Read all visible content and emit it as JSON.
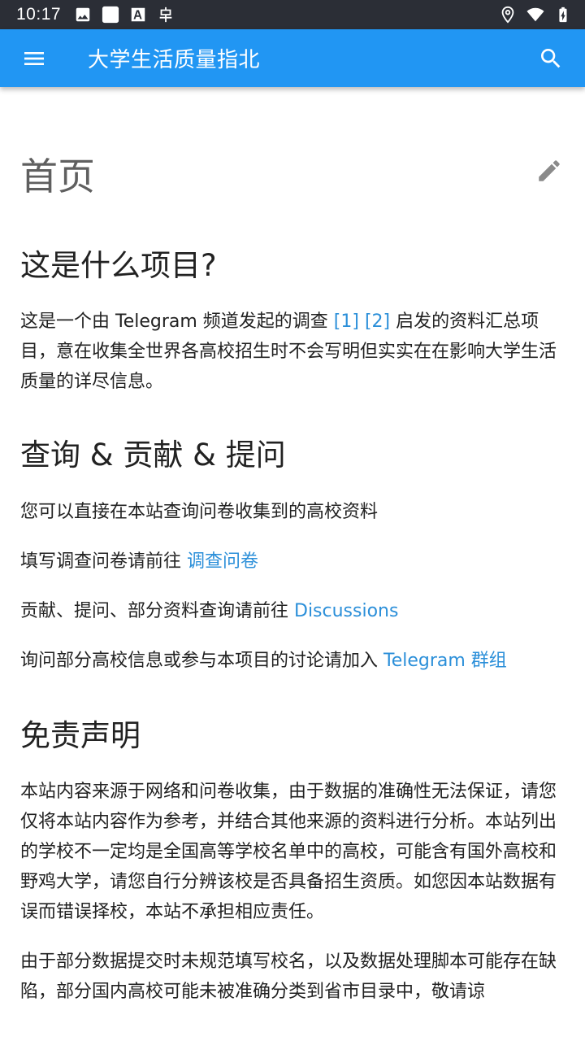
{
  "status_bar": {
    "time": "10:17",
    "left_icons": [
      "image-icon",
      "square-icon",
      "font-icon",
      "bug-icon"
    ],
    "right_icons": [
      "location-icon",
      "wifi-icon",
      "battery-charging-icon"
    ]
  },
  "app_bar": {
    "title": "大学生活质量指北",
    "menu_icon": "menu-icon",
    "search_icon": "search-icon",
    "color": "#2196f3"
  },
  "page": {
    "title": "首页",
    "edit_icon": "pencil-icon"
  },
  "sections": {
    "about": {
      "heading": "这是什么项目?",
      "p1_before": "这是一个由 Telegram 频道发起的调查 ",
      "ref1": "[1]",
      "ref2": "[2]",
      "p1_after": " 启发的资料汇总项目，意在收集全世界各高校招生时不会写明但实实在在影响大学生活质量的详尽信息。"
    },
    "query": {
      "heading": "查询 & 贡献 & 提问",
      "p1": "您可以直接在本站查询问卷收集到的高校资料",
      "p2_before": "填写调查问卷请前往 ",
      "p2_link": "调查问卷",
      "p3_before": "贡献、提问、部分资料查询请前往 ",
      "p3_link": "Discussions",
      "p4_before": "询问部分高校信息或参与本项目的讨论请加入 ",
      "p4_link": "Telegram 群组"
    },
    "disclaimer": {
      "heading": "免责声明",
      "p1": "本站内容来源于网络和问卷收集，由于数据的准确性无法保证，请您仅将本站内容作为参考，并结合其他来源的资料进行分析。本站列出的学校不一定均是全国高等学校名单中的高校，可能含有国外高校和野鸡大学，请您自行分辨该校是否具备招生资质。如您因本站数据有误而错误择校，本站不承担相应责任。",
      "p2": "由于部分数据提交时未规范填写校名，以及数据处理脚本可能存在缺陷，部分国内高校可能未被准确分类到省市目录中，敬请谅"
    }
  },
  "colors": {
    "link": "#2b8fd9",
    "status_bar": "#2b2e36",
    "text": "#222222"
  }
}
